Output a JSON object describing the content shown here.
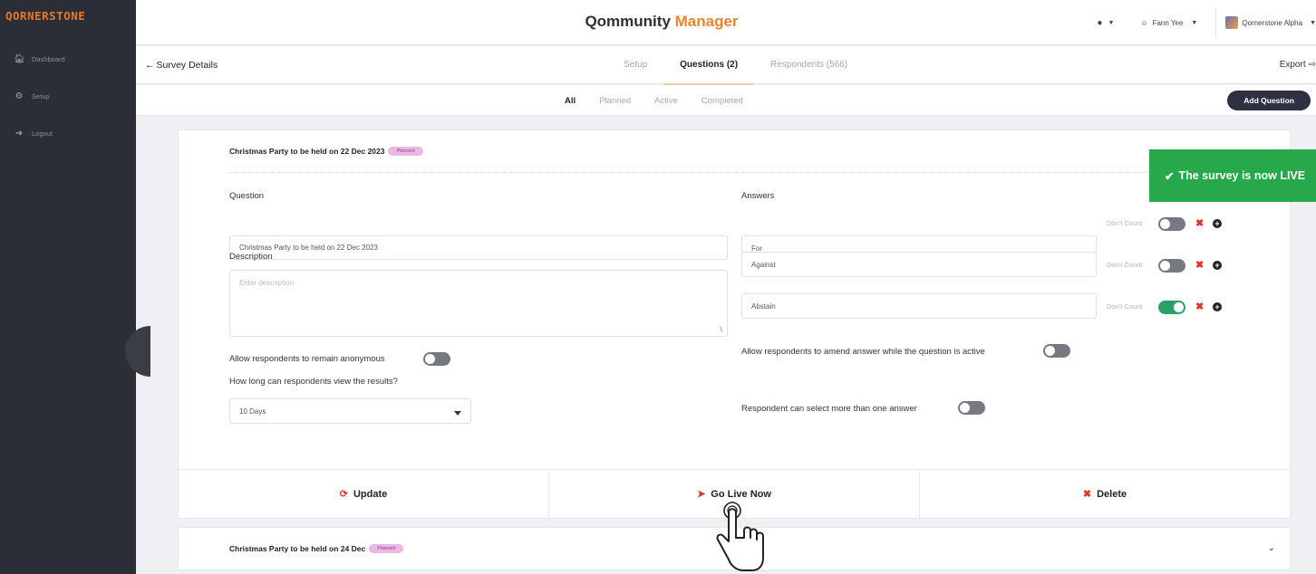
{
  "sidebar": {
    "logo": "QORNERSTONE",
    "items": [
      {
        "label": "Dashboard",
        "icon": "home-icon"
      },
      {
        "label": "Setup",
        "icon": "gear-icon"
      },
      {
        "label": "Logout",
        "icon": "logout-icon"
      }
    ]
  },
  "header": {
    "title_main": "Qommunity ",
    "title_accent": "Manager",
    "user_name": "Fann Yee",
    "org_name": "Qornerstone Alpha"
  },
  "subheader": {
    "back_label": "Survey Details",
    "tabs": [
      {
        "label": "Setup",
        "active": false
      },
      {
        "label": "Questions (2)",
        "active": true
      },
      {
        "label": "Respondents (566)",
        "active": false
      }
    ],
    "export_label": "Export"
  },
  "filters": {
    "items": [
      {
        "label": "All",
        "active": true
      },
      {
        "label": "Planned",
        "active": false
      },
      {
        "label": "Active",
        "active": false
      },
      {
        "label": "Completed",
        "active": false
      }
    ],
    "add_button": "Add Question"
  },
  "question_card": {
    "title": "Christmas Party to be held on 22 Dec 2023",
    "status": "Planned",
    "question_label": "Question",
    "question_value": "Christmas Party to be held on 22 Dec 2023",
    "description_label": "Description",
    "description_placeholder": "Enter description",
    "anonymous_label": "Allow respondents to remain anonymous",
    "anonymous_on": false,
    "view_results_label": "How long can respondents view the results?",
    "view_results_value": "10 Days",
    "answers_label": "Answers",
    "dont_count_label": "Don't Count",
    "answers": [
      {
        "value": "For",
        "dont_count": false
      },
      {
        "value": "Against",
        "dont_count": false
      },
      {
        "value": "Abstain",
        "dont_count": true
      }
    ],
    "amend_label": "Allow respondents to amend answer while the question is active",
    "amend_on": false,
    "multi_label": "Respondent can select more than one answer",
    "multi_on": false,
    "actions": {
      "update": "Update",
      "go_live": "Go Live Now",
      "delete": "Delete"
    }
  },
  "question_card_2": {
    "title": "Christmas Party to be held on 24 Dec",
    "status": "Planned"
  },
  "toast": {
    "message": "The survey is now LIVE",
    "color": "#27a84a"
  },
  "colors": {
    "accent": "#e8862b",
    "sidebar": "#2b2e34",
    "danger": "#e0322b",
    "toggle_on": "#2aa06a"
  }
}
